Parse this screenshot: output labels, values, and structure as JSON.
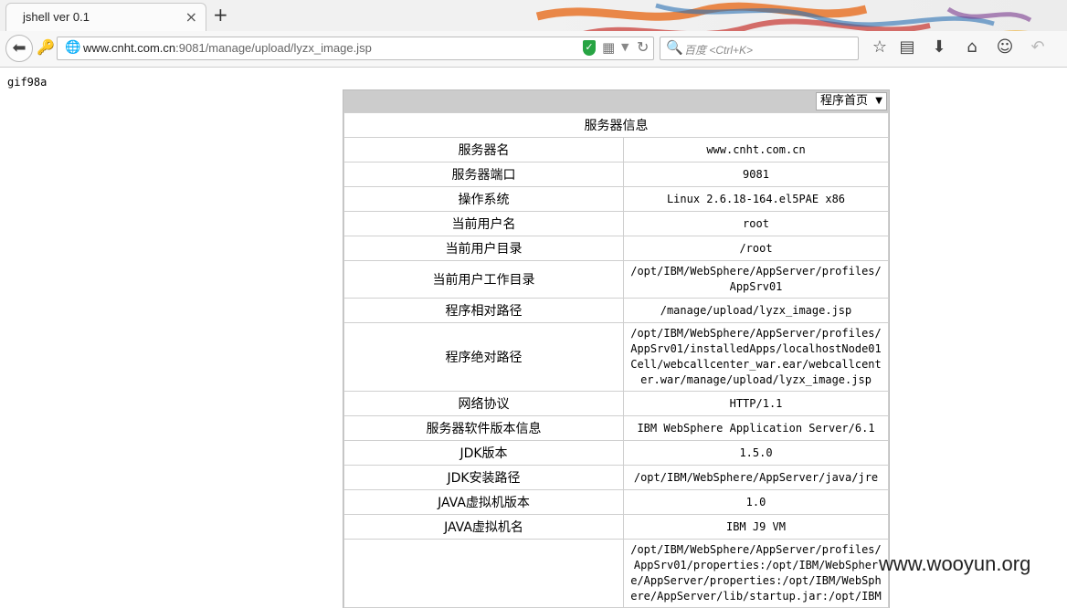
{
  "browser": {
    "tab_title": "jshell ver 0.1",
    "tab_close": "×",
    "new_tab": "+",
    "url_host": "www.cnht.com.cn",
    "url_path": ":9081/manage/upload/lyzx_image.jsp",
    "search_placeholder": "百度 <Ctrl+K>"
  },
  "page": {
    "gif_header": "gif98a",
    "home_select": "程序首页",
    "panel_title": "服务器信息",
    "rows": [
      {
        "label": "服务器名",
        "value": "www.cnht.com.cn"
      },
      {
        "label": "服务器端口",
        "value": "9081"
      },
      {
        "label": "操作系统",
        "value": "Linux 2.6.18-164.el5PAE x86"
      },
      {
        "label": "当前用户名",
        "value": "root"
      },
      {
        "label": "当前用户目录",
        "value": "/root"
      },
      {
        "label": "当前用户工作目录",
        "value": "/opt/IBM/WebSphere/AppServer/profiles/AppSrv01"
      },
      {
        "label": "程序相对路径",
        "value": "/manage/upload/lyzx_image.jsp"
      },
      {
        "label": "程序绝对路径",
        "value": "/opt/IBM/WebSphere/AppServer/profiles/AppSrv01/installedApps/localhostNode01Cell/webcallcenter_war.ear/webcallcenter.war/manage/upload/lyzx_image.jsp"
      },
      {
        "label": "网络协议",
        "value": "HTTP/1.1"
      },
      {
        "label": "服务器软件版本信息",
        "value": "IBM WebSphere Application Server/6.1"
      },
      {
        "label": "JDK版本",
        "value": "1.5.0"
      },
      {
        "label": "JDK安装路径",
        "value": "/opt/IBM/WebSphere/AppServer/java/jre"
      },
      {
        "label": "JAVA虚拟机版本",
        "value": "1.0"
      },
      {
        "label": "JAVA虚拟机名",
        "value": "IBM J9 VM"
      },
      {
        "label": "",
        "value": "/opt/IBM/WebSphere/AppServer/profiles/AppSrv01/properties:/opt/IBM/WebSphere/AppServer/properties:/opt/IBM/WebSphere/AppServer/lib/startup.jar:/opt/IBM"
      }
    ],
    "watermark": "www.wooyun.org"
  },
  "colors": {
    "panel_header": "#cccccc",
    "shield_green": "#27a443"
  }
}
